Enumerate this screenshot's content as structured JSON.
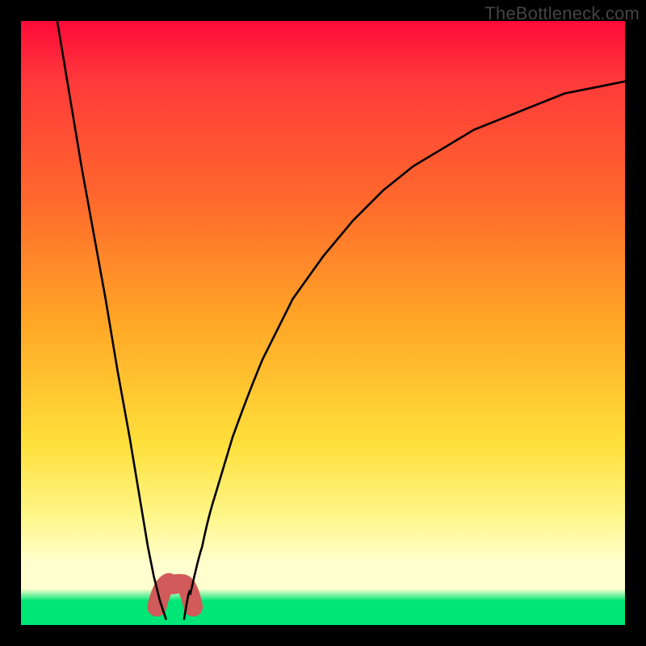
{
  "watermark": "TheBottleneck.com",
  "chart_data": {
    "type": "line",
    "title": "",
    "xlabel": "",
    "ylabel": "",
    "xlim": [
      0,
      100
    ],
    "ylim": [
      0,
      100
    ],
    "grid": false,
    "legend": false,
    "series": [
      {
        "name": "curve-left",
        "x": [
          6,
          8,
          10,
          12,
          14,
          16,
          18,
          20,
          21,
          22,
          23,
          24
        ],
        "y": [
          100,
          88,
          76,
          65,
          54,
          42,
          31,
          19,
          13,
          8,
          4,
          1
        ]
      },
      {
        "name": "curve-right",
        "x": [
          27,
          28,
          29,
          30,
          32,
          35,
          40,
          45,
          50,
          55,
          60,
          65,
          70,
          75,
          80,
          85,
          90,
          95,
          100
        ],
        "y": [
          1,
          5,
          9,
          13,
          21,
          31,
          44,
          54,
          61,
          67,
          72,
          76,
          79,
          82,
          84,
          86,
          88,
          89,
          90
        ]
      },
      {
        "name": "bump",
        "x": [
          22.5,
          23.5,
          24.5,
          25.5,
          26.5,
          27.5,
          28.5
        ],
        "y": [
          3,
          6,
          7,
          6.2,
          6.8,
          6,
          3
        ]
      }
    ],
    "bump_color": "#d15a5a",
    "curve_color": "#000000"
  }
}
